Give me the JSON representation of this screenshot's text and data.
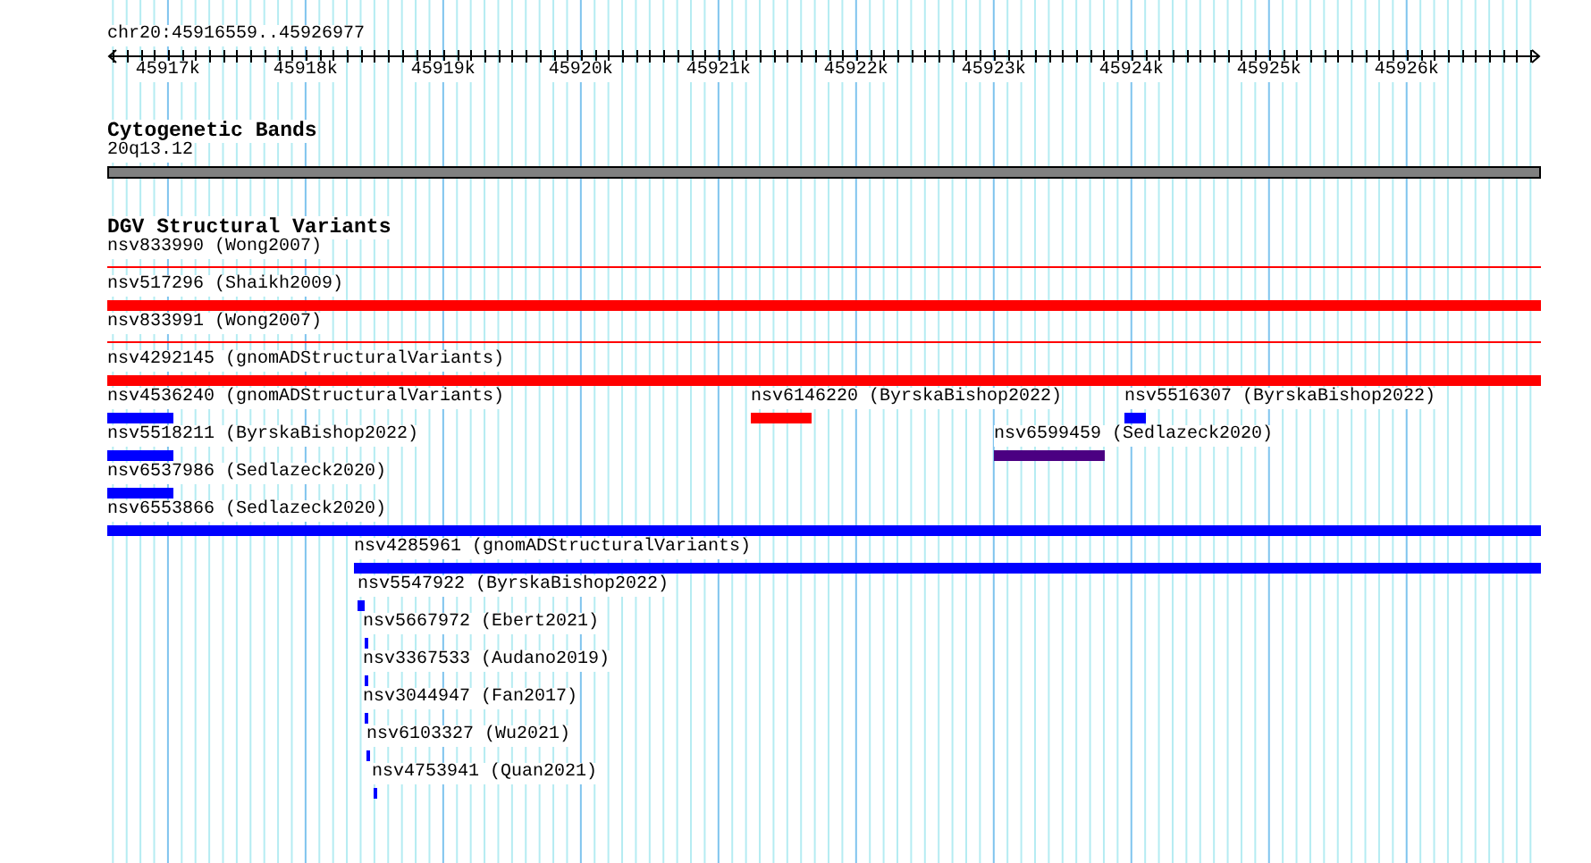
{
  "locus": "chr20:45916559..45926977",
  "ruler": {
    "tick_labels": [
      "45917k",
      "45918k",
      "45919k",
      "45920k",
      "45921k",
      "45922k",
      "45923k",
      "45924k",
      "45925k",
      "45926k"
    ]
  },
  "cytoband_track": {
    "title": "Cytogenetic Bands",
    "bands": [
      {
        "label": "20q13.12"
      }
    ]
  },
  "variant_track": {
    "title": "DGV Structural Variants",
    "features": [
      {
        "label": "nsv833990 (Wong2007)",
        "kind": "line",
        "color": "#ff0000"
      },
      {
        "label": "nsv517296 (Shaikh2009)",
        "kind": "bar",
        "color": "#ff0000"
      },
      {
        "label": "nsv833991 (Wong2007)",
        "kind": "line",
        "color": "#ff0000"
      },
      {
        "label": "nsv4292145 (gnomADStructuralVariants)",
        "kind": "bar",
        "color": "#ff0000"
      },
      {
        "label": "nsv4536240 (gnomADStructuralVariants)",
        "kind": "bar",
        "color": "#0000ff"
      },
      {
        "label": "nsv6146220 (ByrskaBishop2022)",
        "kind": "bar",
        "color": "#ff0000"
      },
      {
        "label": "nsv5516307 (ByrskaBishop2022)",
        "kind": "bar",
        "color": "#0000ff"
      },
      {
        "label": "nsv5518211 (ByrskaBishop2022)",
        "kind": "bar",
        "color": "#0000ff"
      },
      {
        "label": "nsv6599459 (Sedlazeck2020)",
        "kind": "bar",
        "color": "#4b0082"
      },
      {
        "label": "nsv6537986 (Sedlazeck2020)",
        "kind": "bar",
        "color": "#0000ff"
      },
      {
        "label": "nsv6553866 (Sedlazeck2020)",
        "kind": "bar",
        "color": "#0000ff"
      },
      {
        "label": "nsv4285961 (gnomADStructuralVariants)",
        "kind": "bar",
        "color": "#0000ff"
      },
      {
        "label": "nsv5547922 (ByrskaBishop2022)",
        "kind": "bar",
        "color": "#0000ff"
      },
      {
        "label": "nsv5667972 (Ebert2021)",
        "kind": "bar",
        "color": "#0000ff"
      },
      {
        "label": "nsv3367533 (Audano2019)",
        "kind": "bar",
        "color": "#0000ff"
      },
      {
        "label": "nsv3044947 (Fan2017)",
        "kind": "bar",
        "color": "#0000ff"
      },
      {
        "label": "nsv6103327 (Wu2021)",
        "kind": "bar",
        "color": "#0000ff"
      },
      {
        "label": "nsv4753941 (Quan2021)",
        "kind": "bar",
        "color": "#0000ff"
      }
    ]
  }
}
